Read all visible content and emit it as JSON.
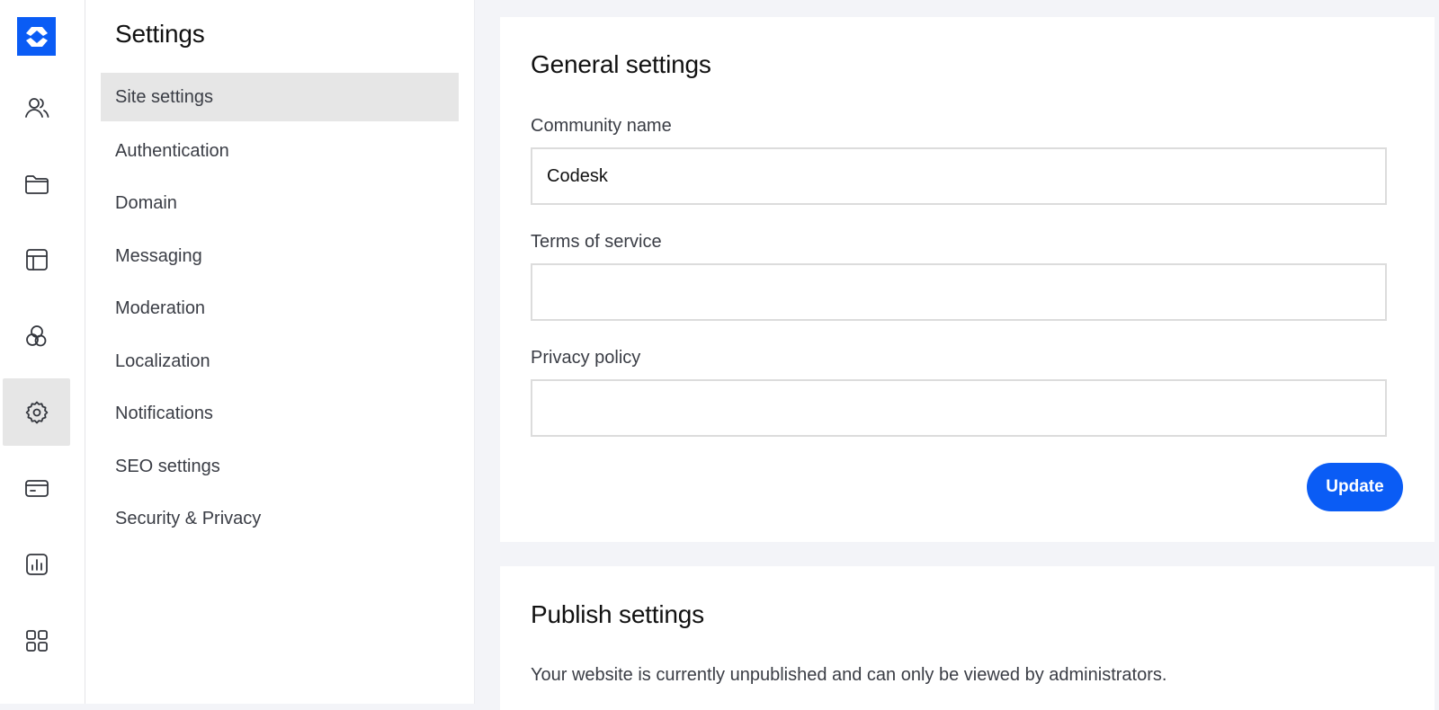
{
  "rail": {
    "logo": "brand-logo",
    "items": [
      {
        "icon": "users-icon",
        "label": "Members",
        "active": false
      },
      {
        "icon": "folder-icon",
        "label": "Content",
        "active": false
      },
      {
        "icon": "layout-icon",
        "label": "Layout",
        "active": false
      },
      {
        "icon": "appearance-icon",
        "label": "Appearance",
        "active": false
      },
      {
        "icon": "gear-icon",
        "label": "Settings",
        "active": true
      },
      {
        "icon": "credit-card-icon",
        "label": "Billing",
        "active": false
      },
      {
        "icon": "bar-chart-icon",
        "label": "Analytics",
        "active": false
      },
      {
        "icon": "apps-grid-icon",
        "label": "Apps",
        "active": false
      }
    ]
  },
  "subnav": {
    "title": "Settings",
    "items": [
      {
        "label": "Site settings",
        "active": true
      },
      {
        "label": "Authentication"
      },
      {
        "label": "Domain"
      },
      {
        "label": "Messaging"
      },
      {
        "label": "Moderation"
      },
      {
        "label": "Localization"
      },
      {
        "label": "Notifications"
      },
      {
        "label": "SEO settings"
      },
      {
        "label": "Security & Privacy"
      }
    ]
  },
  "general": {
    "title": "General settings",
    "community_name": {
      "label": "Community name",
      "value": "Codesk",
      "placeholder": ""
    },
    "terms": {
      "label": "Terms of service",
      "value": "",
      "placeholder": ""
    },
    "privacy": {
      "label": "Privacy policy",
      "value": "",
      "placeholder": ""
    },
    "update_label": "Update"
  },
  "publish": {
    "title": "Publish settings",
    "description": "Your website is currently unpublished and can only be viewed by administrators."
  },
  "colors": {
    "accent": "#0a5cf5",
    "active_bg": "#e6e6e6",
    "page_bg": "#f3f4f8"
  }
}
